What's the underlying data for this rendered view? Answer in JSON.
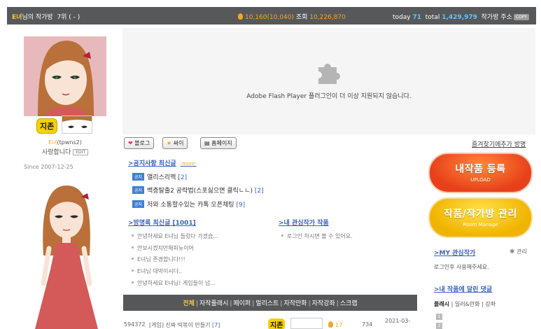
{
  "header": {
    "owner": "E녀",
    "owner_suffix": "님의 작가방",
    "rank": "7위 ( - )",
    "likes": "10,160",
    "likes_paren": "(10,040)",
    "views_label": "조회",
    "views": "10,226,870",
    "today_label": "today",
    "today": "71",
    "total_label": "total",
    "total": "1,429,979",
    "address_label": "작가방 주소",
    "copy_label": "COPY"
  },
  "profile": {
    "rank_badge": "지존",
    "nickname": "E녀",
    "userid": "(tpwns2)",
    "greeting": "사랑합니다",
    "edit_label": "EDIT",
    "since": "Since 2007-12-25"
  },
  "flash": {
    "message": "Adobe Flash Player 플러그인이 더 이상 지원되지 않습니다."
  },
  "buttons": {
    "blog": "블로그",
    "cyworld": "싸이",
    "homepage": "홈페이지",
    "favorite": "즐겨찾기에추가 방명"
  },
  "notice": {
    "title": ">공지사항 최신글",
    "more": "-more-",
    "tag": "공지",
    "items": [
      {
        "text": "앨리스리멕",
        "count": "[2]"
      },
      {
        "text": "백층탈출2 공략법(스포싫으면 클릭ㄴㄴ)",
        "count": "[2]"
      },
      {
        "text": "저와 소통할수있는 카톡 오픈채팅",
        "count": "[9]"
      }
    ]
  },
  "guestbook": {
    "title": ">방명록 최신글 [1001]",
    "items": [
      "안녕하세요 E녀님 들렀다 가겠습...",
      "안보시겠지만해피뉴이어",
      "E녀님 존경합니다!!!",
      "E녀님 대박이시다..",
      "안녕하세요 E녀님! 게임들이 넘..."
    ]
  },
  "interest": {
    "title": ">내 관심작가 작품",
    "message": "로그인 하시면 볼 수 있어요."
  },
  "categories": {
    "active": "전체",
    "items": [
      "자작플래시",
      "페이퍼",
      "멀리스트",
      "자작만화",
      "자작강좌",
      "스크랩"
    ]
  },
  "list_row": {
    "id": "594372",
    "title": "[게임] 진짜 떡볶이 만들기",
    "count": "[7]",
    "badge": "지존",
    "likes": "17",
    "views": "734",
    "date": "2021-03-"
  },
  "right": {
    "upload_title": "내작품 등록",
    "upload_sub": "UPLOAD",
    "manage_title": "작품/작가방 관리",
    "manage_sub": "Room Manage",
    "my_interest_title": ">MY 관심작가",
    "manage_link": "관리",
    "login_msg": "로그인후 사용해주세요.",
    "comments_title": ">내 작품에 달린 댓글",
    "comment_tabs": [
      "플래시",
      "일러&만화",
      "강좌"
    ],
    "page_nums": [
      "1",
      "2"
    ]
  },
  "colors": {
    "topbar": "#56585a",
    "highlight_yellow": "#f6c744",
    "accent_orange": "#f5a623",
    "accent_cyan": "#5fc5ff",
    "link_blue": "#3b5fc0",
    "upload_red": "#e8401a",
    "manage_yellow": "#f0b400"
  }
}
